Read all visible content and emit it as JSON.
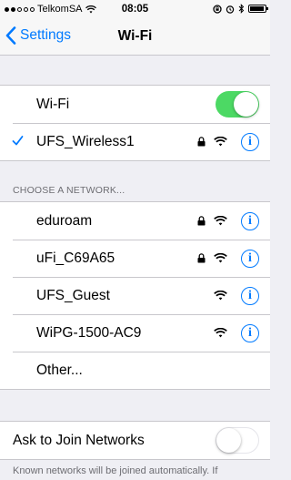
{
  "status_bar": {
    "carrier": "TelkomSA",
    "time": "08:05",
    "signal_bars_filled": 2,
    "signal_bars_total": 5,
    "battery_level": 0.95
  },
  "nav": {
    "back_label": "Settings",
    "title": "Wi-Fi"
  },
  "wifi_toggle": {
    "label": "Wi-Fi",
    "on": true
  },
  "connected_network": {
    "name": "UFS_Wireless1",
    "secured": true
  },
  "networks_header": "CHOOSE A NETWORK...",
  "networks": [
    {
      "name": "eduroam",
      "secured": true
    },
    {
      "name": "uFi_C69A65",
      "secured": true
    },
    {
      "name": "UFS_Guest",
      "secured": false
    },
    {
      "name": "WiPG-1500-AC9",
      "secured": false
    }
  ],
  "other_label": "Other...",
  "ask_to_join": {
    "label": "Ask to Join Networks",
    "on": false
  },
  "footer_text": "Known networks will be joined automatically. If",
  "colors": {
    "accent": "#007aff",
    "toggle_on": "#4cd964",
    "background": "#efeff4"
  },
  "icons": {
    "check": "checkmark-icon",
    "lock": "lock-icon",
    "wifi": "wifi-icon",
    "info": "info-icon"
  }
}
